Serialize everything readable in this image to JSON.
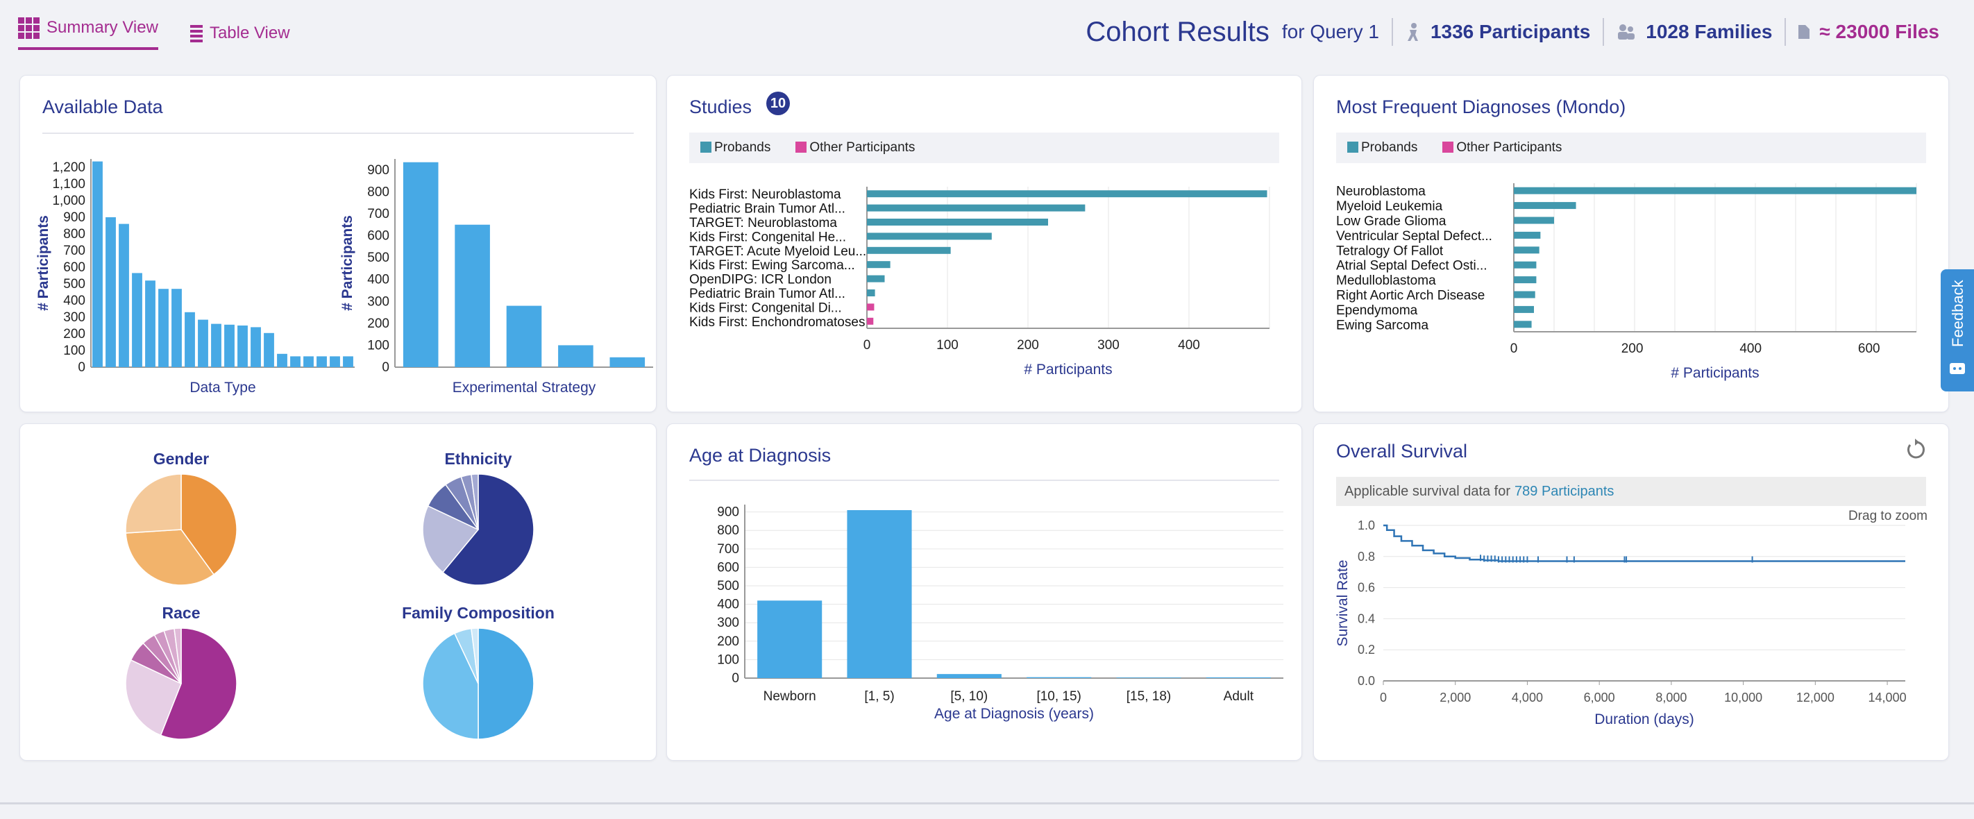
{
  "header": {
    "tabs": [
      {
        "label": "Summary View",
        "active": true
      },
      {
        "label": "Table View",
        "active": false
      }
    ],
    "title": "Cohort Results",
    "subtitle": "for Query 1",
    "participants": "1336 Participants",
    "families": "1028 Families",
    "files": "≈ 23000 Files"
  },
  "available_data": {
    "title": "Available Data",
    "chart_data": [
      {
        "type": "bar",
        "xlabel": "Data Type",
        "ylabel": "# Participants",
        "yticks": [
          "0",
          "100",
          "200",
          "300",
          "400",
          "500",
          "600",
          "700",
          "800",
          "900",
          "1,000",
          "1,100",
          "1,200"
        ],
        "ylim": [
          0,
          1250
        ],
        "values": [
          1235,
          900,
          860,
          565,
          520,
          470,
          470,
          330,
          285,
          260,
          255,
          250,
          240,
          205,
          80,
          65,
          65,
          65,
          65,
          65
        ]
      },
      {
        "type": "bar",
        "xlabel": "Experimental Strategy",
        "ylabel": "# Participants",
        "yticks": [
          "0",
          "100",
          "200",
          "300",
          "400",
          "500",
          "600",
          "700",
          "800",
          "900"
        ],
        "ylim": [
          0,
          950
        ],
        "values": [
          935,
          650,
          280,
          100,
          45
        ]
      }
    ]
  },
  "studies": {
    "title": "Studies",
    "count": "10",
    "legend": [
      {
        "label": "Probands",
        "color": "#4198ae"
      },
      {
        "label": "Other Participants",
        "color": "#d9479c"
      }
    ],
    "chart_data": {
      "type": "bar",
      "orientation": "horizontal",
      "xlabel": "# Participants",
      "xticks": [
        "0",
        "100",
        "200",
        "300",
        "400"
      ],
      "xlim": [
        0,
        500
      ],
      "categories": [
        "Kids First: Neuroblastoma",
        "Pediatric Brain Tumor Atl...",
        "TARGET: Neuroblastoma",
        "Kids First: Congenital He...",
        "TARGET: Acute Myeloid Leu...",
        "Kids First: Ewing Sarcoma...",
        "OpenDIPG: ICR London",
        "Pediatric Brain Tumor Atl...",
        "Kids First: Congenital Di...",
        "Kids First: Enchondromatoses"
      ],
      "series": [
        {
          "name": "Probands",
          "values": [
            497,
            271,
            225,
            155,
            104,
            29,
            22,
            10,
            0,
            0
          ]
        },
        {
          "name": "Other Participants",
          "values": [
            0,
            0,
            0,
            0,
            0,
            0,
            0,
            0,
            9,
            8
          ]
        }
      ]
    }
  },
  "diagnoses": {
    "title": "Most Frequent Diagnoses (Mondo)",
    "legend": [
      {
        "label": "Probands",
        "color": "#4198ae"
      },
      {
        "label": "Other Participants",
        "color": "#d9479c"
      }
    ],
    "chart_data": {
      "type": "bar",
      "orientation": "horizontal",
      "xlabel": "# Participants",
      "xticks": [
        "0",
        "200",
        "400",
        "600"
      ],
      "xlim": [
        0,
        680
      ],
      "categories": [
        "Neuroblastoma",
        "Myeloid Leukemia",
        "Low Grade Glioma",
        "Ventricular Septal Defect...",
        "Tetralogy Of Fallot",
        "Atrial Septal Defect Osti...",
        "Medulloblastoma",
        "Right Aortic Arch Disease",
        "Ependymoma",
        "Ewing Sarcoma"
      ],
      "series": [
        {
          "name": "Probands",
          "values": [
            680,
            105,
            68,
            45,
            43,
            38,
            38,
            36,
            34,
            30
          ]
        }
      ]
    }
  },
  "demographics": {
    "chart_data": [
      {
        "type": "pie",
        "title": "Gender",
        "values": [
          0.4,
          0.34,
          0.26
        ],
        "colors": [
          "#eb953f",
          "#f2b36b",
          "#f4c99a"
        ]
      },
      {
        "type": "pie",
        "title": "Ethnicity",
        "values": [
          0.61,
          0.21,
          0.08,
          0.05,
          0.03,
          0.02
        ],
        "colors": [
          "#2b388f",
          "#b8bbda",
          "#5b68a8",
          "#7f88bd",
          "#8e95c5",
          "#a3a9d3"
        ]
      },
      {
        "type": "pie",
        "title": "Race",
        "values": [
          0.56,
          0.26,
          0.06,
          0.04,
          0.03,
          0.03,
          0.02
        ],
        "colors": [
          "#a23092",
          "#e6cfe5",
          "#b767a9",
          "#c583b8",
          "#cf98c4",
          "#d8aace",
          "#e0bad8"
        ]
      },
      {
        "type": "pie",
        "title": "Family Composition",
        "values": [
          0.5,
          0.43,
          0.05,
          0.02
        ],
        "colors": [
          "#47a9e5",
          "#6ec0ee",
          "#a2d7f4",
          "#cfe9f8"
        ]
      }
    ]
  },
  "age": {
    "title": "Age at Diagnosis",
    "chart_data": {
      "type": "bar",
      "xlabel": "Age at Diagnosis (years)",
      "ylabel": "",
      "yticks": [
        "0",
        "100",
        "200",
        "300",
        "400",
        "500",
        "600",
        "700",
        "800",
        "900"
      ],
      "ylim": [
        0,
        940
      ],
      "categories": [
        "Newborn",
        "[1, 5)",
        "[5, 10)",
        "[10, 15)",
        "[15, 18)",
        "Adult"
      ],
      "values": [
        420,
        910,
        22,
        5,
        3,
        4
      ]
    }
  },
  "survival": {
    "title": "Overall Survival",
    "note_prefix": "Applicable survival data for",
    "note_link": "789 Participants",
    "zoom_hint": "Drag to zoom",
    "chart_data": {
      "type": "line",
      "xlabel": "Duration (days)",
      "ylabel": "Survival Rate",
      "xticks": [
        "0",
        "2,000",
        "4,000",
        "6,000",
        "8,000",
        "10,000",
        "12,000",
        "14,000"
      ],
      "yticks": [
        "0.0",
        "0.2",
        "0.4",
        "0.6",
        "0.8",
        "1.0"
      ],
      "xlim": [
        0,
        14500
      ],
      "ylim": [
        0,
        1.0
      ],
      "x": [
        0,
        100,
        300,
        500,
        800,
        1100,
        1400,
        1700,
        2000,
        2400,
        2800,
        3200,
        4000,
        14500
      ],
      "y": [
        1.0,
        0.97,
        0.93,
        0.9,
        0.87,
        0.84,
        0.82,
        0.8,
        0.79,
        0.78,
        0.775,
        0.77,
        0.77,
        0.77
      ],
      "censor_x": [
        2700,
        2800,
        2900,
        3000,
        3100,
        3200,
        3300,
        3400,
        3500,
        3600,
        3700,
        3800,
        3900,
        4000,
        4300,
        5100,
        5300,
        6700,
        6750,
        10250
      ]
    }
  },
  "feedback": {
    "label": "Feedback"
  }
}
